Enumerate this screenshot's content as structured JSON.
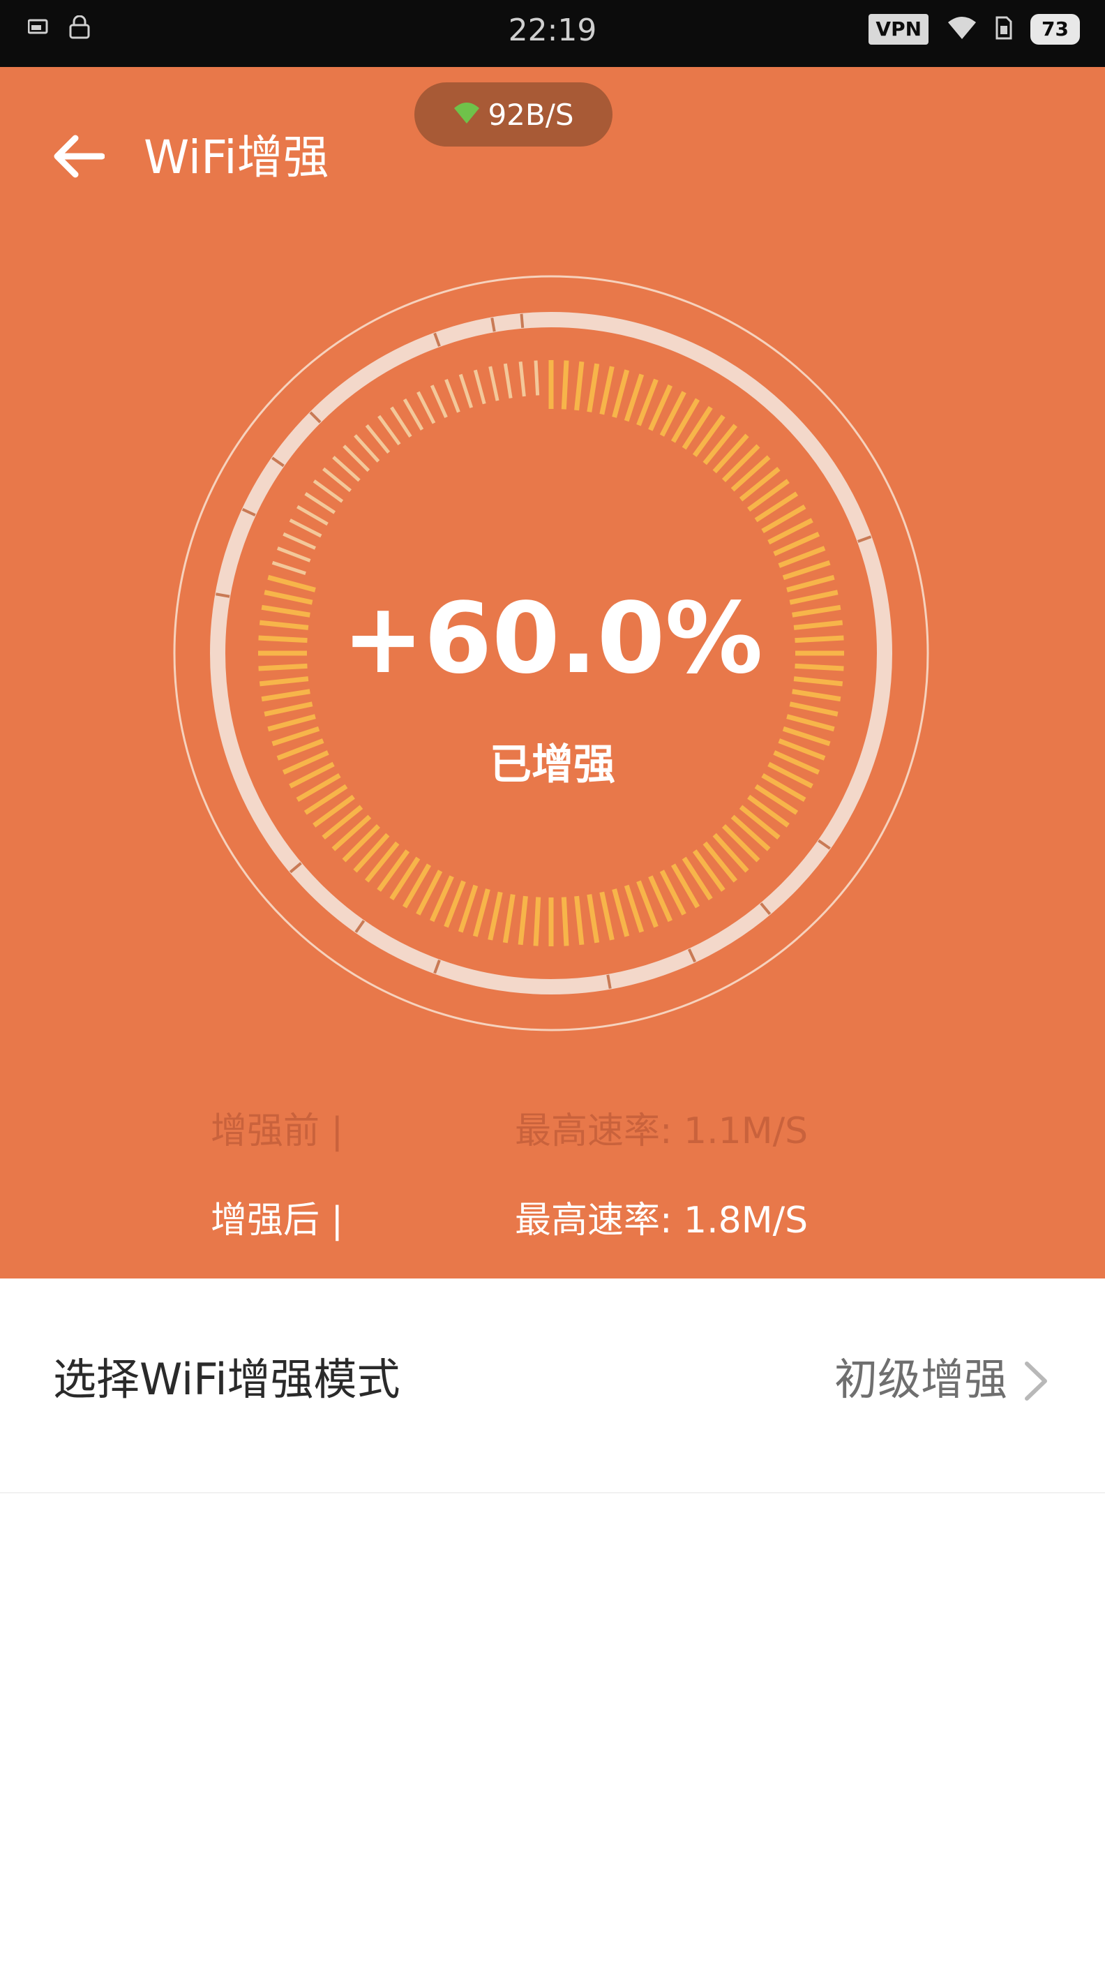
{
  "status_bar": {
    "time": "22:19",
    "vpn_label": "VPN",
    "battery_level": "73",
    "icons": [
      "notification-icon",
      "lock-icon",
      "wifi-icon",
      "sim-icon",
      "battery-icon"
    ]
  },
  "header": {
    "title": "WiFi增强",
    "speed_indicator": "92B/S",
    "back_icon": "arrow-left-icon"
  },
  "gauge": {
    "value": "+60.0%",
    "label": "已增强",
    "progress_fraction": 0.8
  },
  "stats": {
    "before": {
      "label": "增强前 |",
      "value": "最高速率: 1.1M/S"
    },
    "after": {
      "label": "增强后 |",
      "value": "最高速率: 1.8M/S"
    }
  },
  "mode": {
    "title": "选择WiFi增强模式",
    "value": "初级增强",
    "chevron_icon": "chevron-right-icon"
  },
  "colors": {
    "accent": "#e8784a",
    "tick_active": "#f7b54a",
    "tick_inactive": "#f3c89a",
    "speed_pill": "#a85a36",
    "status_bar": "#0c0c0c"
  }
}
